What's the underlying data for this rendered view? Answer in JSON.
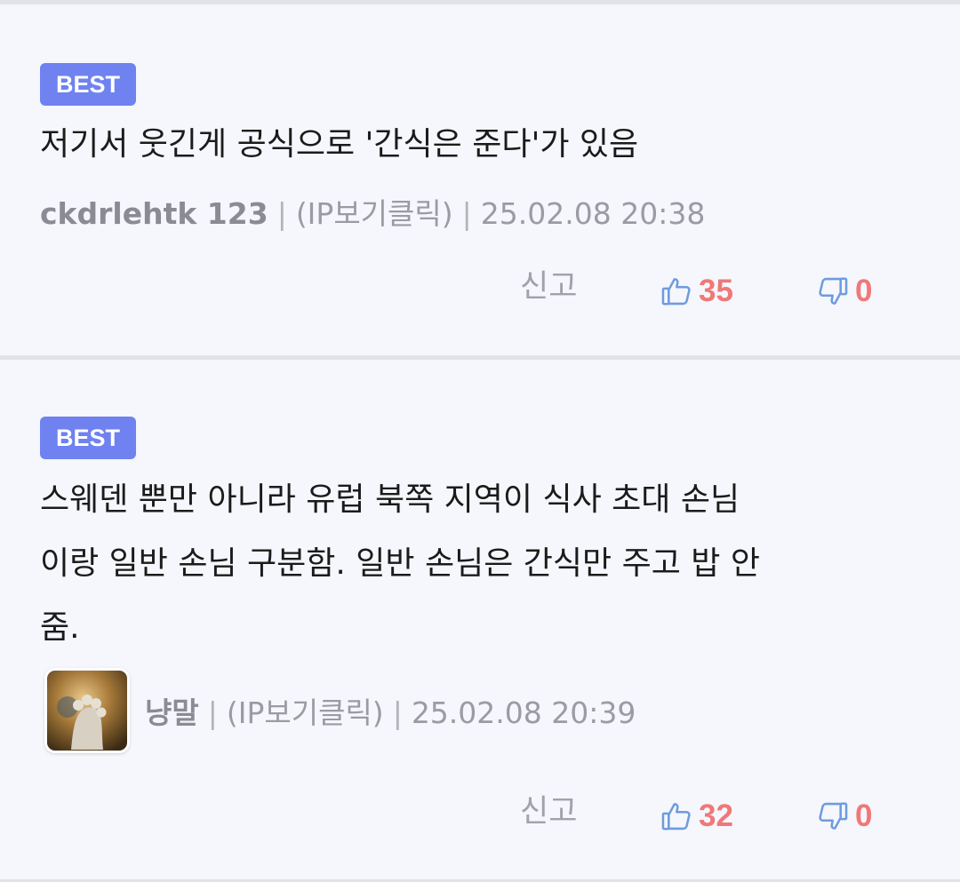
{
  "comments": [
    {
      "badge": "BEST",
      "text": "저기서 웃긴게 공식으로 '간식은 준다'가 있음",
      "author": "ckdrlehtk 123",
      "ip_label": "(IP보기클릭)",
      "datetime": "25.02.08 20:38",
      "report_label": "신고",
      "likes": "35",
      "dislikes": "0"
    },
    {
      "badge": "BEST",
      "text": "스웨덴 뿐만 아니라 유럽 북쪽 지역이 식사 초대 손님\n이랑 일반 손님 구분함. 일반 손님은 간식만 주고 밥 안\n줌.",
      "author": "냥말",
      "ip_label": "(IP보기클릭)",
      "datetime": "25.02.08 20:39",
      "report_label": "신고",
      "likes": "32",
      "dislikes": "0"
    }
  ],
  "icons": {
    "thumbs_up": "thumbs-up-icon",
    "thumbs_down": "thumbs-down-icon"
  },
  "colors": {
    "badge": "#6f82f0",
    "vote_count": "#f07878",
    "vote_icon": "#6f9be0"
  },
  "separator": "|"
}
